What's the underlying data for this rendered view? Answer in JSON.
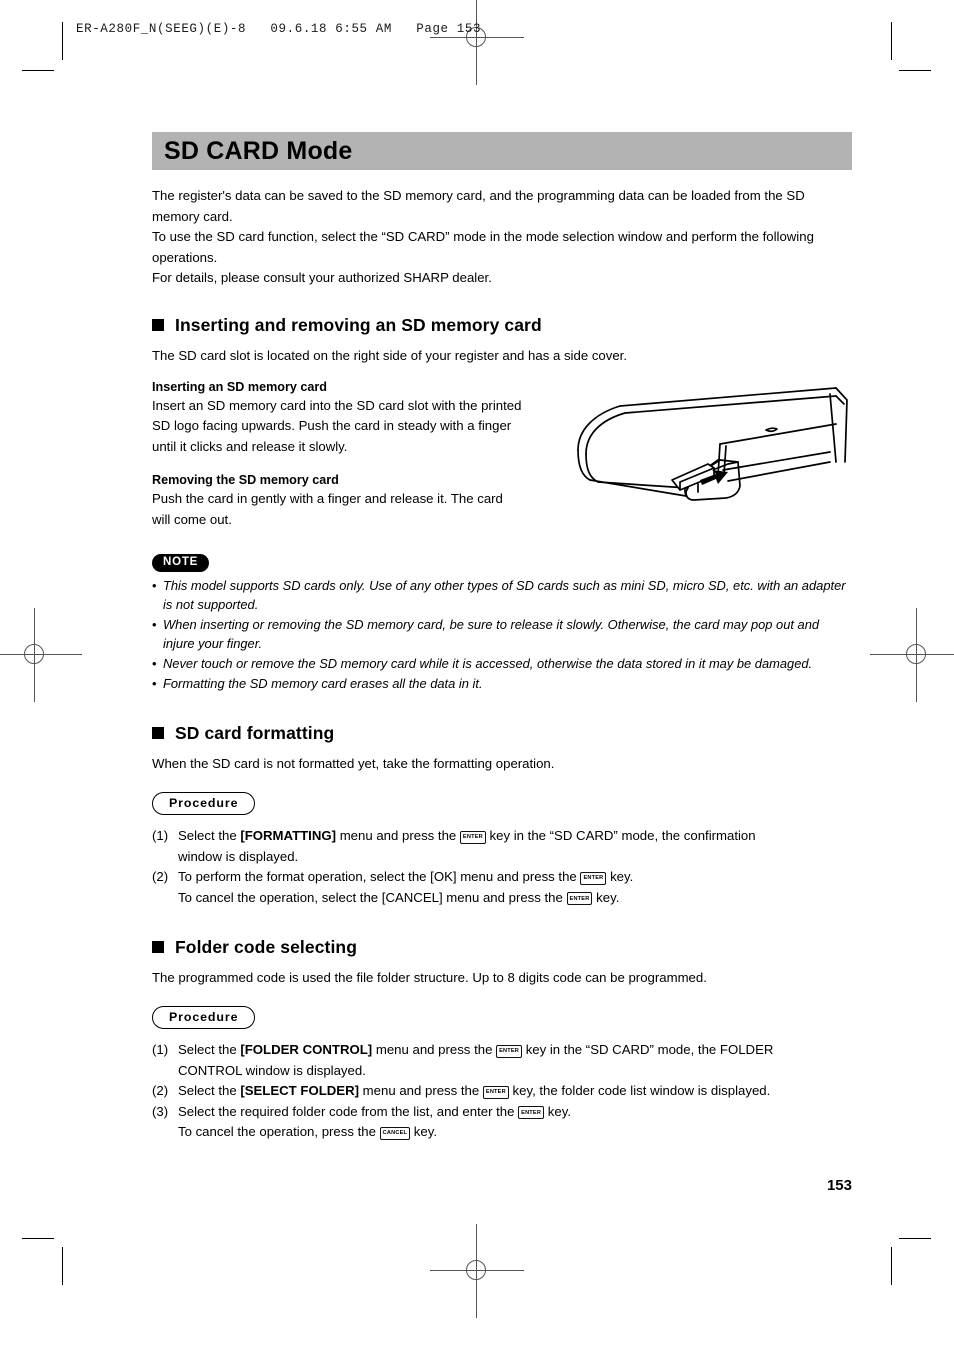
{
  "film_header": "ER-A280F_N(SEEG)(E)-8   09.6.18 6:55 AM   Page 153",
  "colors": {
    "title_bar_gray": "#b3b3b3",
    "note_badge_bg": "#000000",
    "text": "#000000",
    "reg_mark": "#555555"
  },
  "page_title": "SD CARD Mode",
  "intro": [
    "The register's data can be saved to the SD memory card, and the programming data can be loaded from the SD memory card.",
    "To use the SD card function, select the “SD CARD” mode in the mode selection window and perform the following operations.",
    "For details, please consult your authorized SHARP dealer."
  ],
  "sections": [
    {
      "heading": "Inserting and removing an SD memory card",
      "lead": "The SD card slot is located on the right side of your register and has a side cover.",
      "sub1_head": "Inserting an SD memory card",
      "sub1_body": "Insert an SD memory card into the SD card slot with the printed SD logo facing upwards. Push the card in steady with a finger until it clicks and release it slowly.",
      "sub2_head": "Removing the SD memory card",
      "sub2_body": "Push the card in gently with a finger and release it. The card will come out."
    },
    {
      "heading": "SD card formatting",
      "lead": "When the SD card is not formatted yet, take the formatting operation."
    },
    {
      "heading": "Folder code selecting",
      "lead": "The programmed code is used the file folder structure. Up to 8 digits code can be programmed."
    }
  ],
  "note": {
    "badge": "NOTE",
    "items": [
      "This model supports SD cards only. Use of any other types of SD cards such as mini SD, micro SD, etc. with an adapter is not supported.",
      "When inserting or removing the SD memory card, be sure to release it slowly. Otherwise, the card may pop out and injure your finger.",
      "Never touch or remove the SD memory card while it is accessed, otherwise the data stored in it may be damaged.",
      "Formatting the SD memory card erases all the data in it."
    ]
  },
  "procedure_label": "Procedure",
  "keys": {
    "enter": "ENTER",
    "cancel": "CANCEL"
  },
  "formatting_steps": {
    "s1_num": "(1)",
    "s1_a": "Select the ",
    "s1_kw": "[FORMATTING]",
    "s1_b": " menu and press the ",
    "s1_c": " key in the “SD CARD” mode, the confirmation",
    "s1_cont": "window is displayed.",
    "s2_num": "(2)",
    "s2_a": "To perform the format operation, select the [OK] menu and press the ",
    "s2_b": " key.",
    "s2_cont_a": "To cancel the operation, select the [CANCEL] menu and press the ",
    "s2_cont_b": " key."
  },
  "folder_steps": {
    "s1_num": "(1)",
    "s1_a": "Select the ",
    "s1_kw": "[FOLDER CONTROL]",
    "s1_b": " menu and press the ",
    "s1_c": " key in the “SD CARD” mode, the FOLDER",
    "s1_cont": "CONTROL window is displayed.",
    "s2_num": "(2)",
    "s2_a": "Select the ",
    "s2_kw": "[SELECT FOLDER]",
    "s2_b": " menu and press the ",
    "s2_c": " key, the folder code list window is displayed.",
    "s3_num": "(3)",
    "s3_a": "Select the required folder code from the list, and enter the ",
    "s3_b": " key.",
    "s3_cont_a": "To cancel the operation, press the ",
    "s3_cont_b": " key."
  },
  "page_number": "153"
}
